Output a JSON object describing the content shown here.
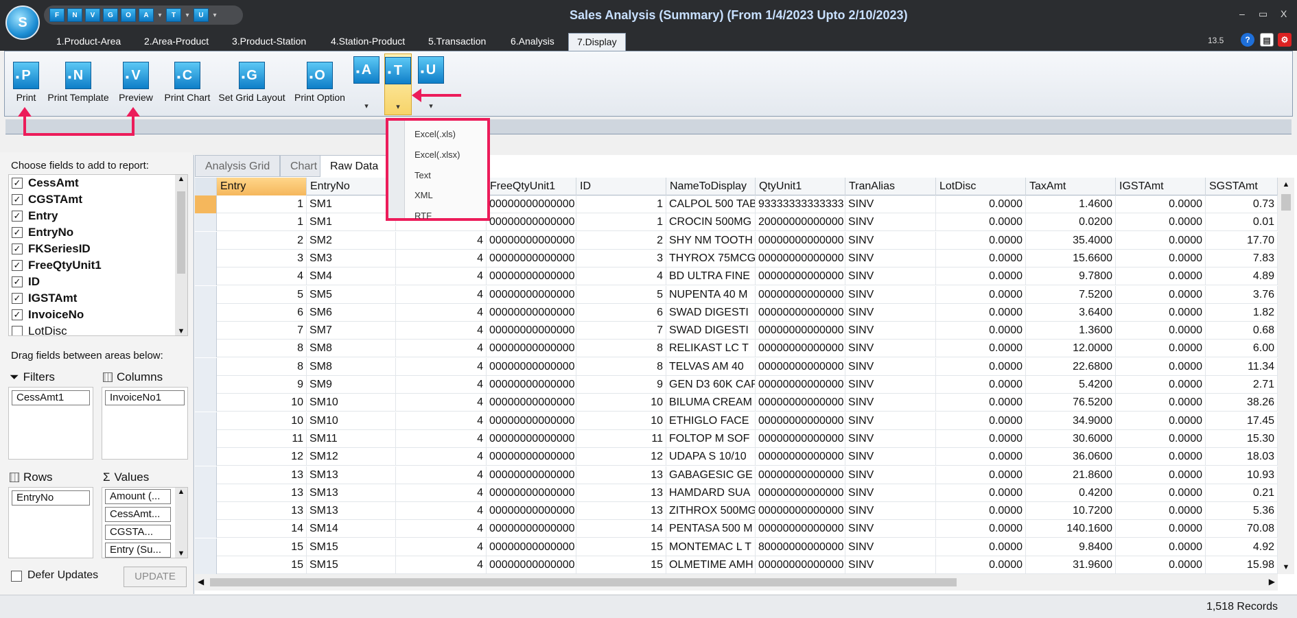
{
  "window": {
    "title": "Sales Analysis (Summary) (From 1/4/2023 Upto 2/10/2023)",
    "minimize": "–",
    "maximize": "▭",
    "close": "X",
    "version": "13.5"
  },
  "qat": {
    "buttons": [
      "F",
      "N",
      "V",
      "G",
      "O",
      "A",
      "T",
      "U"
    ]
  },
  "menu_tabs": [
    "1.Product-Area",
    "2.Area-Product",
    "3.Product-Station",
    "4.Station-Product",
    "5.Transaction",
    "6.Analysis",
    "7.Display"
  ],
  "ribbon": {
    "buttons": [
      {
        "label": "Print",
        "icon": "P"
      },
      {
        "label": "Print Template",
        "icon": "N"
      },
      {
        "label": "Preview",
        "icon": "V"
      },
      {
        "label": "Print Chart",
        "icon": "C"
      },
      {
        "label": "Set Grid Layout",
        "icon": "G"
      },
      {
        "label": "Print Option",
        "icon": "O"
      }
    ],
    "split_buttons": [
      "A",
      "T",
      "U"
    ]
  },
  "export_menu": [
    "Excel(.xls)",
    "Excel(.xlsx)",
    "Text",
    "XML",
    "RTF"
  ],
  "field_chooser": {
    "title": "Choose fields to add to report:",
    "fields": [
      {
        "name": "CessAmt",
        "checked": true
      },
      {
        "name": "CGSTAmt",
        "checked": true
      },
      {
        "name": "Entry",
        "checked": true
      },
      {
        "name": "EntryNo",
        "checked": true
      },
      {
        "name": "FKSeriesID",
        "checked": true
      },
      {
        "name": "FreeQtyUnit1",
        "checked": true
      },
      {
        "name": "ID",
        "checked": true
      },
      {
        "name": "IGSTAmt",
        "checked": true
      },
      {
        "name": "InvoiceNo",
        "checked": true
      },
      {
        "name": "LotDisc",
        "checked": false
      }
    ],
    "drag_label": "Drag fields between areas below:",
    "filters": {
      "title": "Filters",
      "items": [
        "CessAmt1"
      ]
    },
    "columns": {
      "title": "Columns",
      "items": [
        "InvoiceNo1"
      ]
    },
    "rows": {
      "title": "Rows",
      "items": [
        "EntryNo"
      ]
    },
    "values": {
      "title": "Values",
      "items": [
        "Amount (...",
        "CessAmt...",
        "CGSTA...",
        "Entry (Su..."
      ]
    },
    "defer_label": "Defer Updates",
    "update_label": "UPDATE"
  },
  "grid_tabs": [
    "Analysis Grid",
    "Chart",
    "Raw Data"
  ],
  "grid": {
    "headers": [
      "Entry",
      "EntryNo",
      "",
      "FreeQtyUnit1",
      "ID",
      "NameToDisplay",
      "QtyUnit1",
      "TranAlias",
      "LotDisc",
      "TaxAmt",
      "IGSTAmt",
      "SGSTAmt"
    ],
    "rows": [
      [
        "1",
        "SM1",
        "",
        "00000000000000",
        "1",
        "CALPOL 500 TAB",
        "93333333333333",
        "SINV",
        "0.0000",
        "1.4600",
        "0.0000",
        "0.73"
      ],
      [
        "1",
        "SM1",
        "",
        "00000000000000",
        "1",
        "CROCIN 500MG",
        "20000000000000",
        "SINV",
        "0.0000",
        "0.0200",
        "0.0000",
        "0.01"
      ],
      [
        "2",
        "SM2",
        "4",
        "00000000000000",
        "2",
        "SHY NM TOOTH",
        "00000000000000",
        "SINV",
        "0.0000",
        "35.4000",
        "0.0000",
        "17.70"
      ],
      [
        "3",
        "SM3",
        "4",
        "00000000000000",
        "3",
        "THYROX 75MCG",
        "00000000000000",
        "SINV",
        "0.0000",
        "15.6600",
        "0.0000",
        "7.83"
      ],
      [
        "4",
        "SM4",
        "4",
        "00000000000000",
        "4",
        "BD ULTRA FINE",
        "00000000000000",
        "SINV",
        "0.0000",
        "9.7800",
        "0.0000",
        "4.89"
      ],
      [
        "5",
        "SM5",
        "4",
        "00000000000000",
        "5",
        "NUPENTA 40 M",
        "00000000000000",
        "SINV",
        "0.0000",
        "7.5200",
        "0.0000",
        "3.76"
      ],
      [
        "6",
        "SM6",
        "4",
        "00000000000000",
        "6",
        "SWAD DIGESTI",
        "00000000000000",
        "SINV",
        "0.0000",
        "3.6400",
        "0.0000",
        "1.82"
      ],
      [
        "7",
        "SM7",
        "4",
        "00000000000000",
        "7",
        "SWAD DIGESTI",
        "00000000000000",
        "SINV",
        "0.0000",
        "1.3600",
        "0.0000",
        "0.68"
      ],
      [
        "8",
        "SM8",
        "4",
        "00000000000000",
        "8",
        "RELIKAST LC T",
        "00000000000000",
        "SINV",
        "0.0000",
        "12.0000",
        "0.0000",
        "6.00"
      ],
      [
        "8",
        "SM8",
        "4",
        "00000000000000",
        "8",
        "TELVAS AM 40",
        "00000000000000",
        "SINV",
        "0.0000",
        "22.6800",
        "0.0000",
        "11.34"
      ],
      [
        "9",
        "SM9",
        "4",
        "00000000000000",
        "9",
        "GEN D3 60K CAP",
        "00000000000000",
        "SINV",
        "0.0000",
        "5.4200",
        "0.0000",
        "2.71"
      ],
      [
        "10",
        "SM10",
        "4",
        "00000000000000",
        "10",
        "BILUMA CREAM",
        "00000000000000",
        "SINV",
        "0.0000",
        "76.5200",
        "0.0000",
        "38.26"
      ],
      [
        "10",
        "SM10",
        "4",
        "00000000000000",
        "10",
        "ETHIGLO FACE",
        "00000000000000",
        "SINV",
        "0.0000",
        "34.9000",
        "0.0000",
        "17.45"
      ],
      [
        "11",
        "SM11",
        "4",
        "00000000000000",
        "11",
        "FOLTOP M SOF",
        "00000000000000",
        "SINV",
        "0.0000",
        "30.6000",
        "0.0000",
        "15.30"
      ],
      [
        "12",
        "SM12",
        "4",
        "00000000000000",
        "12",
        "UDAPA S 10/10",
        "00000000000000",
        "SINV",
        "0.0000",
        "36.0600",
        "0.0000",
        "18.03"
      ],
      [
        "13",
        "SM13",
        "4",
        "00000000000000",
        "13",
        "GABAGESIC GE",
        "00000000000000",
        "SINV",
        "0.0000",
        "21.8600",
        "0.0000",
        "10.93"
      ],
      [
        "13",
        "SM13",
        "4",
        "00000000000000",
        "13",
        "HAMDARD SUA",
        "00000000000000",
        "SINV",
        "0.0000",
        "0.4200",
        "0.0000",
        "0.21"
      ],
      [
        "13",
        "SM13",
        "4",
        "00000000000000",
        "13",
        "ZITHROX 500MG",
        "00000000000000",
        "SINV",
        "0.0000",
        "10.7200",
        "0.0000",
        "5.36"
      ],
      [
        "14",
        "SM14",
        "4",
        "00000000000000",
        "14",
        "PENTASA 500 M",
        "00000000000000",
        "SINV",
        "0.0000",
        "140.1600",
        "0.0000",
        "70.08"
      ],
      [
        "15",
        "SM15",
        "4",
        "00000000000000",
        "15",
        "MONTEMAC L T",
        "80000000000000",
        "SINV",
        "0.0000",
        "9.8400",
        "0.0000",
        "4.92"
      ],
      [
        "15",
        "SM15",
        "4",
        "00000000000000",
        "15",
        "OLMETIME AMH",
        "00000000000000",
        "SINV",
        "0.0000",
        "31.9600",
        "0.0000",
        "15.98"
      ]
    ]
  },
  "status": {
    "records": "1,518 Records"
  },
  "colors": {
    "accent": "#ec1c5a",
    "titlebar": "#2b2d30",
    "icon": "#0e7ec8"
  }
}
